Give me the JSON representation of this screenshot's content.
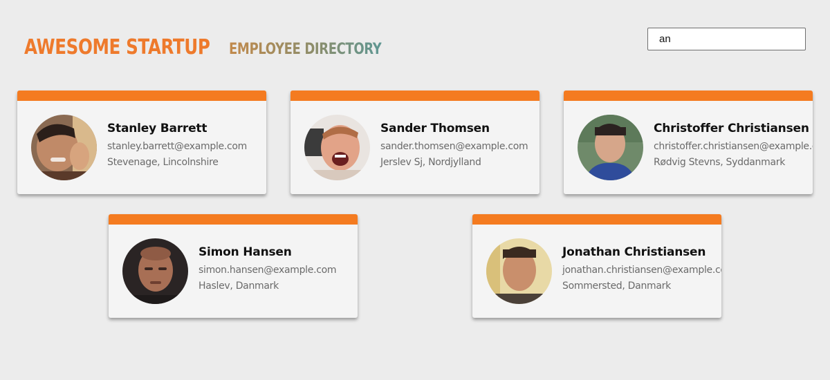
{
  "header": {
    "title_main": "AWESOME STARTUP",
    "title_sub": "EMPLOYEE DIRECTORY"
  },
  "search": {
    "value": "an"
  },
  "colors": {
    "accent": "#f47b20",
    "title_main": "#ee7a2c",
    "background": "#ececec",
    "card": "#f4f4f4"
  },
  "employees": [
    {
      "name": "Stanley Barrett",
      "email": "stanley.barrett@example.com",
      "location": "Stevenage, Lincolnshire"
    },
    {
      "name": "Sander Thomsen",
      "email": "sander.thomsen@example.com",
      "location": "Jerslev Sj, Nordjylland"
    },
    {
      "name": "Christoffer Christiansen",
      "email": "christoffer.christiansen@example.com",
      "location": "Rødvig Stevns, Syddanmark"
    },
    {
      "name": "Simon Hansen",
      "email": "simon.hansen@example.com",
      "location": "Haslev, Danmark"
    },
    {
      "name": "Jonathan Christiansen",
      "email": "jonathan.christiansen@example.com",
      "location": "Sommersted, Danmark"
    }
  ]
}
